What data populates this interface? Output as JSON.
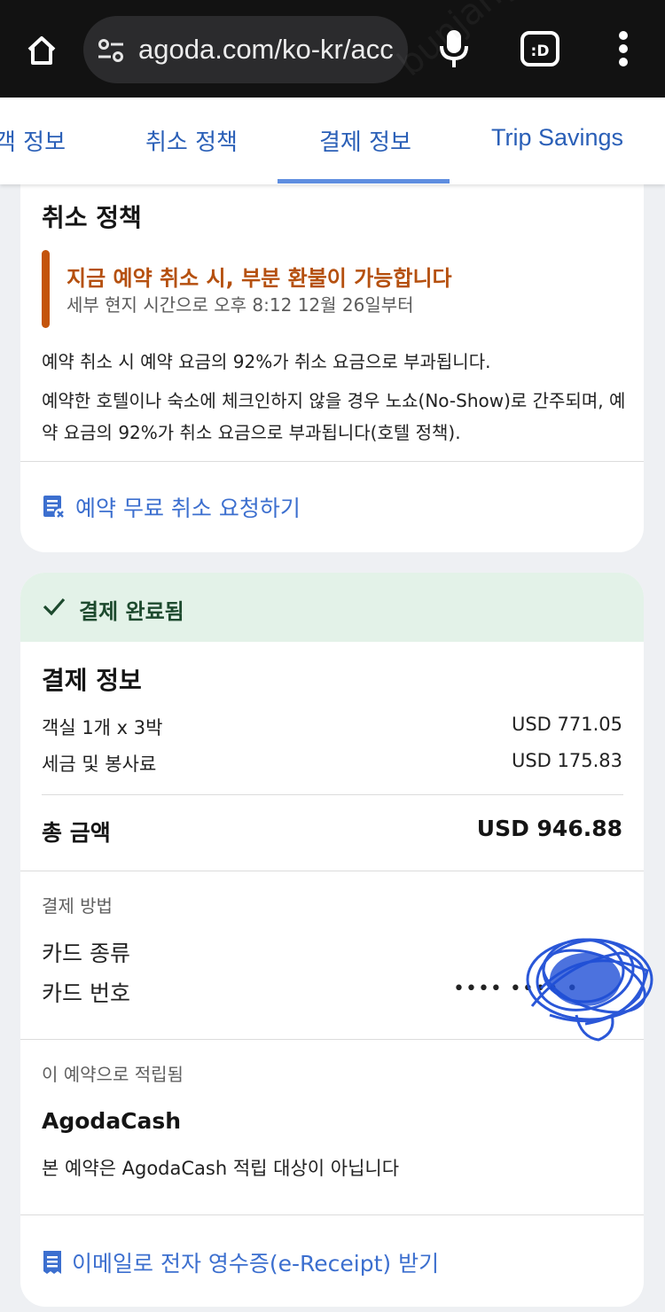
{
  "browser": {
    "url": "agoda.com/ko-kr/acc",
    "icons": [
      "home-icon",
      "page-info-icon",
      "mic-icon",
      "tab-switcher-icon",
      "more-vert-icon"
    ],
    "tab_count": ":D"
  },
  "section_tabs": {
    "items": [
      {
        "label": "객 정보"
      },
      {
        "label": "취소 정책"
      },
      {
        "label": "결제 정보",
        "active": true
      },
      {
        "label": "Trip Savings"
      }
    ],
    "active_color": "#5f8ee0"
  },
  "cancellation": {
    "title": "취소 정책",
    "notice_title": "지금 예약 취소 시, 부분 환불이 가능합니다",
    "notice_sub": "세부 현지 시간으로 오후 8:12 12월 26일부터",
    "para1": "예약 취소 시 예약 요금의 92%가 취소 요금으로 부과됩니다.",
    "para2": "예약한 호텔이나 숙소에 체크인하지 않을 경우 노쇼(No-Show)로 간주되며, 예약 요금의 92%가 취소 요금으로 부과됩니다(호텔 정책).",
    "link": "예약 무료 취소 요청하기",
    "accent_color": "#c4540c"
  },
  "payment": {
    "status": "결제 완료됨",
    "status_color": "#e3f2e8",
    "title": "결제 정보",
    "rows": [
      {
        "label": "객실 1개 x 3박",
        "value": "USD 771.05"
      },
      {
        "label": "세금 및 봉사료",
        "value": "USD 175.83"
      }
    ],
    "total_label": "총 금액",
    "total_value": "USD 946.88",
    "method_heading": "결제 방법",
    "card_type_label": "카드 종류",
    "card_number_label": "카드 번호",
    "card_number_value": "•••• •••• •"
  },
  "rewards": {
    "heading": "이 예약으로 적립됨",
    "name": "AgodaCash",
    "note": "본 예약은 AgodaCash 적립 대상이 아닙니다"
  },
  "receipt_link": "이메일로 전자 영수증(e-Receipt) 받기"
}
